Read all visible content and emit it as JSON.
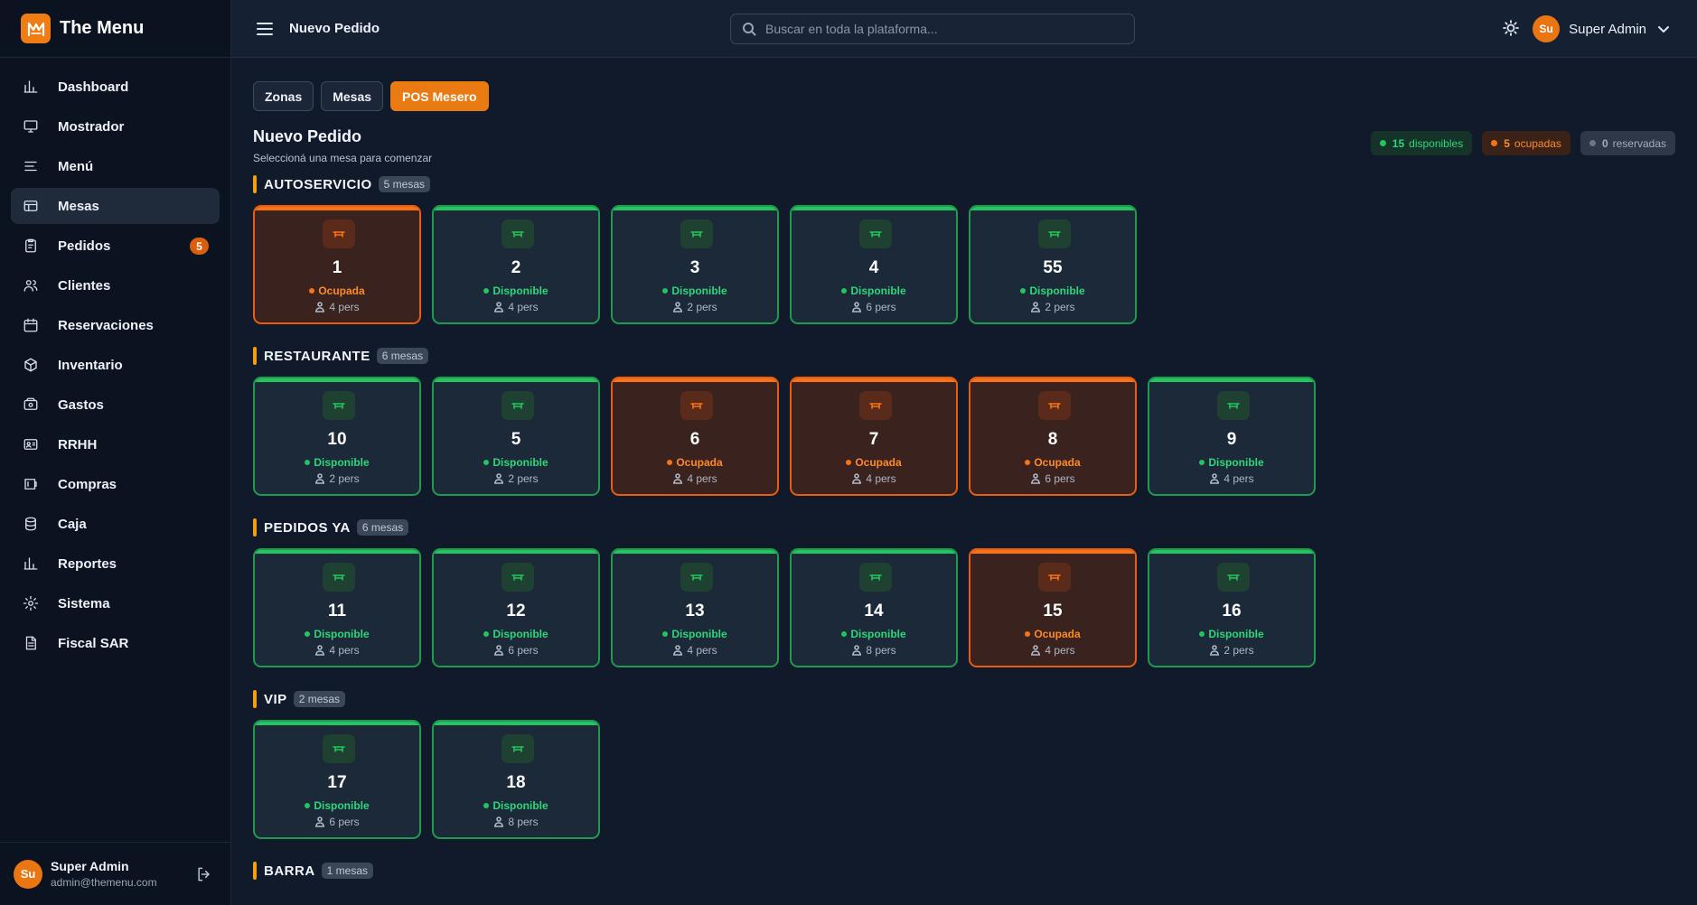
{
  "app": {
    "name": "The Menu"
  },
  "sidebar": {
    "items": [
      {
        "label": "Dashboard",
        "icon": "chart-bar-icon"
      },
      {
        "label": "Mostrador",
        "icon": "monitor-icon"
      },
      {
        "label": "Menú",
        "icon": "menu-lines-icon"
      },
      {
        "label": "Mesas",
        "icon": "table-icon",
        "active": true
      },
      {
        "label": "Pedidos",
        "icon": "clipboard-icon",
        "badge": "5"
      },
      {
        "label": "Clientes",
        "icon": "users-icon"
      },
      {
        "label": "Reservaciones",
        "icon": "calendar-icon"
      },
      {
        "label": "Inventario",
        "icon": "box-icon"
      },
      {
        "label": "Gastos",
        "icon": "wallet-icon"
      },
      {
        "label": "RRHH",
        "icon": "id-card-icon"
      },
      {
        "label": "Compras",
        "icon": "shopping-icon"
      },
      {
        "label": "Caja",
        "icon": "database-icon"
      },
      {
        "label": "Reportes",
        "icon": "report-icon"
      },
      {
        "label": "Sistema",
        "icon": "gear-icon"
      },
      {
        "label": "Fiscal SAR",
        "icon": "document-icon"
      }
    ],
    "user": {
      "initials": "Su",
      "name": "Super Admin",
      "email": "admin@themenu.com"
    }
  },
  "header": {
    "title": "Nuevo Pedido",
    "search_placeholder": "Buscar en toda la plataforma...",
    "user": {
      "initials": "Su",
      "name": "Super Admin"
    }
  },
  "tabs": [
    {
      "label": "Zonas"
    },
    {
      "label": "Mesas"
    },
    {
      "label": "POS Mesero",
      "active": true
    }
  ],
  "page": {
    "title": "Nuevo Pedido",
    "subtitle": "Seleccioná una mesa para comenzar"
  },
  "legend": {
    "available": {
      "count": "15",
      "label": "disponibles"
    },
    "occupied": {
      "count": "5",
      "label": "ocupadas"
    },
    "reserved": {
      "count": "0",
      "label": "reservadas"
    }
  },
  "colors": {
    "accent": "#ea7a12",
    "available": "#22c55e",
    "occupied": "#f97316",
    "zone_marker": "#f59e0b"
  },
  "zones": [
    {
      "name": "AUTOSERVICIO",
      "count": "5 mesas",
      "tables": [
        {
          "number": "1",
          "status": "Ocupada",
          "busy": true,
          "seats": "4 pers"
        },
        {
          "number": "2",
          "status": "Disponible",
          "busy": false,
          "seats": "4 pers"
        },
        {
          "number": "3",
          "status": "Disponible",
          "busy": false,
          "seats": "2 pers"
        },
        {
          "number": "4",
          "status": "Disponible",
          "busy": false,
          "seats": "6 pers"
        },
        {
          "number": "55",
          "status": "Disponible",
          "busy": false,
          "seats": "2 pers"
        }
      ]
    },
    {
      "name": "RESTAURANTE",
      "count": "6 mesas",
      "tables": [
        {
          "number": "10",
          "status": "Disponible",
          "busy": false,
          "seats": "2 pers"
        },
        {
          "number": "5",
          "status": "Disponible",
          "busy": false,
          "seats": "2 pers"
        },
        {
          "number": "6",
          "status": "Ocupada",
          "busy": true,
          "seats": "4 pers"
        },
        {
          "number": "7",
          "status": "Ocupada",
          "busy": true,
          "seats": "4 pers"
        },
        {
          "number": "8",
          "status": "Ocupada",
          "busy": true,
          "seats": "6 pers"
        },
        {
          "number": "9",
          "status": "Disponible",
          "busy": false,
          "seats": "4 pers"
        }
      ]
    },
    {
      "name": "PEDIDOS YA",
      "count": "6 mesas",
      "tables": [
        {
          "number": "11",
          "status": "Disponible",
          "busy": false,
          "seats": "4 pers"
        },
        {
          "number": "12",
          "status": "Disponible",
          "busy": false,
          "seats": "6 pers"
        },
        {
          "number": "13",
          "status": "Disponible",
          "busy": false,
          "seats": "4 pers"
        },
        {
          "number": "14",
          "status": "Disponible",
          "busy": false,
          "seats": "8 pers"
        },
        {
          "number": "15",
          "status": "Ocupada",
          "busy": true,
          "seats": "4 pers"
        },
        {
          "number": "16",
          "status": "Disponible",
          "busy": false,
          "seats": "2 pers"
        }
      ]
    },
    {
      "name": "VIP",
      "count": "2 mesas",
      "tables": [
        {
          "number": "17",
          "status": "Disponible",
          "busy": false,
          "seats": "6 pers"
        },
        {
          "number": "18",
          "status": "Disponible",
          "busy": false,
          "seats": "8 pers"
        }
      ]
    },
    {
      "name": "BARRA",
      "count": "1 mesas",
      "tables": []
    }
  ]
}
